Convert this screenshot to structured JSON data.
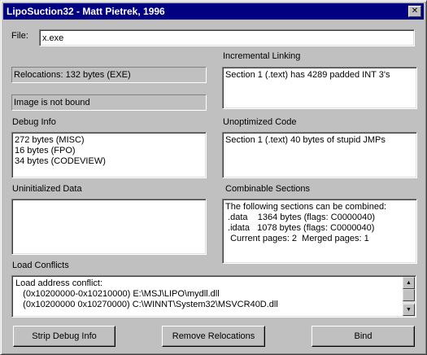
{
  "window": {
    "title": "LipoSuction32 - Matt Pietrek, 1996"
  },
  "file": {
    "label": "File:",
    "value": "x.exe"
  },
  "relocations": "Relocations: 132 bytes (EXE)",
  "binding": "Image is not bound",
  "debug_info": {
    "label": "Debug Info",
    "lines": "272 bytes (MISC)\n16 bytes (FPO)\n34 bytes (CODEVIEW)"
  },
  "uninitialized_data": {
    "label": "Uninitialized Data",
    "lines": ""
  },
  "incremental_linking": {
    "label": "Incremental Linking",
    "lines": "Section 1 (.text) has 4289 padded INT 3's"
  },
  "unoptimized_code": {
    "label": "Unoptimized Code",
    "lines": "Section 1 (.text) 40 bytes of stupid JMPs"
  },
  "combinable_sections": {
    "label": "Combinable Sections",
    "lines": "The following sections can be combined:\n .data    1364 bytes (flags: C0000040)\n .idata   1078 bytes (flags: C0000040)\n  Current pages: 2  Merged pages: 1"
  },
  "load_conflicts": {
    "label": "Load Conflicts",
    "lines": "Load address conflict:\n   (0x10200000-0x10210000) E:\\MSJ\\LIPO\\mydll.dll\n   (0x10200000 0x10270000) C:\\WINNT\\System32\\MSVCR40D.dll"
  },
  "buttons": {
    "strip_debug": "Strip Debug Info",
    "remove_relocations": "Remove Relocations",
    "bind": "Bind"
  },
  "icons": {
    "close": "close-icon",
    "scroll_up": "arrow-up-icon",
    "scroll_down": "arrow-down-icon"
  },
  "colors": {
    "titlebar": "#000080",
    "face": "#c0c0c0"
  }
}
